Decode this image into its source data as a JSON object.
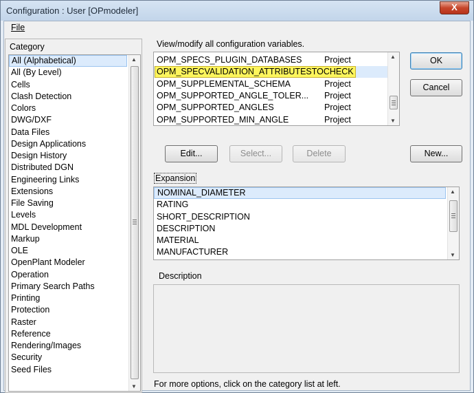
{
  "window": {
    "title": "Configuration : User [OPmodeler]",
    "close_glyph": "X"
  },
  "menu": {
    "file_label": "File"
  },
  "category": {
    "header": "Category",
    "items": [
      "All (Alphabetical)",
      "All (By Level)",
      "Cells",
      "Clash Detection",
      "Colors",
      "DWG/DXF",
      "Data Files",
      "Design Applications",
      "Design History",
      "Distributed DGN",
      "Engineering Links",
      "Extensions",
      "File Saving",
      "Levels",
      "MDL Development",
      "Markup",
      "OLE",
      "OpenPlant Modeler",
      "Operation",
      "Primary Search Paths",
      "Printing",
      "Protection",
      "Raster",
      "Reference",
      "Rendering/Images",
      "Security",
      "Seed Files"
    ],
    "selected_index": 0
  },
  "variables": {
    "caption": "View/modify all configuration variables.",
    "rows": [
      {
        "name": "OPM_SPECS_PLUGIN_DATABASES",
        "level": "Project"
      },
      {
        "name": "OPM_SPECVALIDATION_ATTRIBUTESTOCHECK",
        "level": ""
      },
      {
        "name": "OPM_SUPPLEMENTAL_SCHEMA",
        "level": "Project"
      },
      {
        "name": "OPM_SUPPORTED_ANGLE_TOLER...",
        "level": "Project"
      },
      {
        "name": "OPM_SUPPORTED_ANGLES",
        "level": "Project"
      },
      {
        "name": "OPM_SUPPORTED_MIN_ANGLE",
        "level": "Project"
      }
    ],
    "highlighted_index": 1
  },
  "buttons": {
    "ok": "OK",
    "cancel": "Cancel",
    "edit": "Edit...",
    "select": "Select...",
    "delete": "Delete",
    "new": "New..."
  },
  "expansion": {
    "header": "Expansion",
    "items": [
      "NOMINAL_DIAMETER",
      "RATING",
      "SHORT_DESCRIPTION",
      "DESCRIPTION",
      "MATERIAL",
      "MANUFACTURER"
    ],
    "selected_index": 0
  },
  "description": {
    "header": "Description"
  },
  "footer": {
    "hint": "For more options, click on the category list at left."
  }
}
